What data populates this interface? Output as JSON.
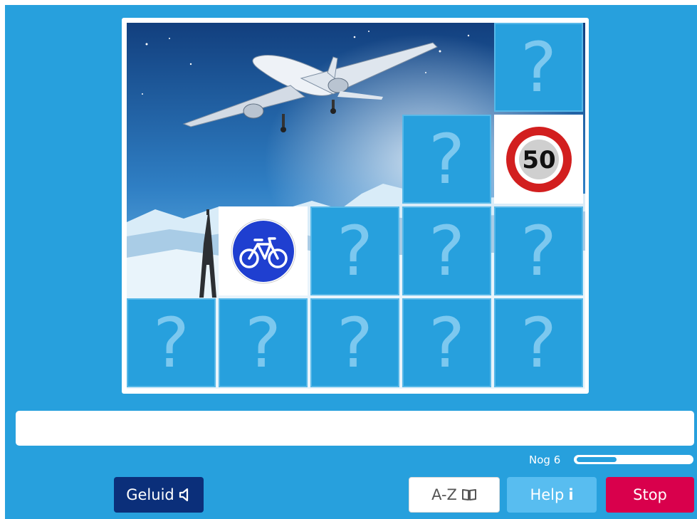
{
  "game": {
    "hidden_symbol": "?",
    "revealed": {
      "speed_sign_text": "50",
      "bike_sign": "bicycle-path-sign"
    },
    "background_picture": "airplane-over-mountains-and-eiffel-tower"
  },
  "answer_field": {
    "value": "",
    "placeholder": ""
  },
  "progress": {
    "label": "Nog 6",
    "fraction": 0.35
  },
  "buttons": {
    "sound": "Geluid",
    "az": "A-Z",
    "help": "Help",
    "help_icon": "i",
    "stop": "Stop"
  },
  "colors": {
    "stage": "#27a0dd",
    "tile": "#27a0dd",
    "question_mark": "#7cc8ef",
    "sound_button": "#0b2f7a",
    "help_button": "#58bdf0",
    "stop_button": "#d9004c",
    "sign_red": "#d21f1f",
    "sign_blue": "#1f3fd0"
  },
  "icons": {
    "sound": "speaker-icon",
    "az": "book-icon",
    "help": "info-icon"
  }
}
